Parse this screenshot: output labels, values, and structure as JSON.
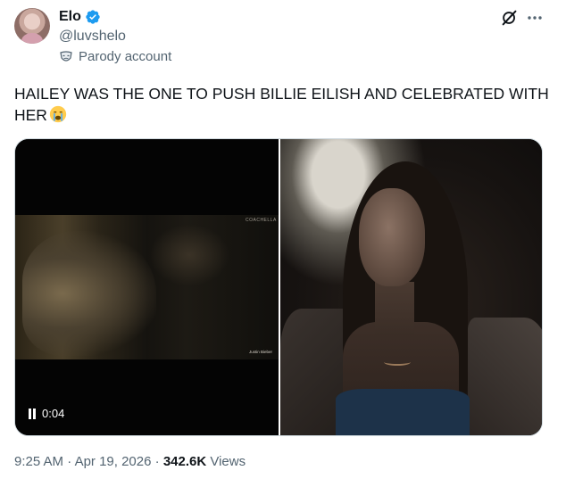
{
  "author": {
    "display_name": "Elo",
    "handle": "@luvshelo",
    "label": "Parody account",
    "verified": true
  },
  "icons": [
    "avatar",
    "verified-badge-icon",
    "parody-mask-icon",
    "grok-icon",
    "more-icon",
    "crying-face-emoji",
    "pause-icon"
  ],
  "tweet": {
    "text": "HAILEY WAS THE ONE TO PUSH BILLIE EILISH AND CELEBRATED WITH HER"
  },
  "media": {
    "video": {
      "time": "0:04",
      "watermark": "COACHELLA",
      "caption": "Justin Bieber"
    }
  },
  "meta": {
    "time": "9:25 AM",
    "sep1": " · ",
    "date": "Apr 19, 2026",
    "sep2": " · ",
    "views_count": "342.6K",
    "views_label": " Views"
  },
  "colors": {
    "verified_blue": "#1d9bf0",
    "secondary_text": "#536471",
    "primary_text": "#0f1419"
  }
}
